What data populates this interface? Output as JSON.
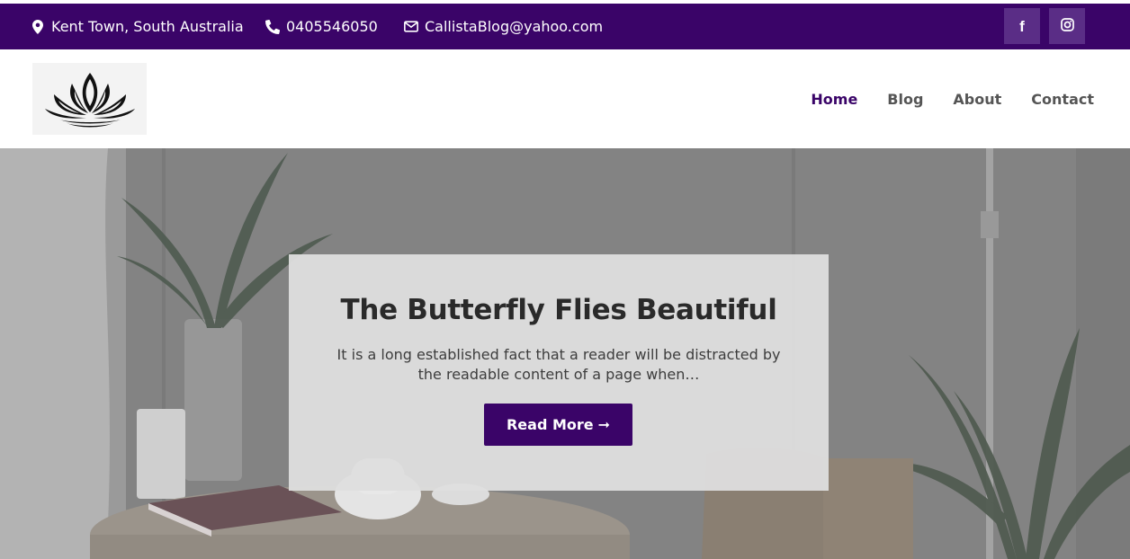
{
  "topbar": {
    "location": "Kent Town, South Australia",
    "phone": "0405546050",
    "email": "CallistaBlog@yahoo.com",
    "social": [
      {
        "icon": "facebook-icon",
        "glyph": "f"
      },
      {
        "icon": "instagram-icon",
        "glyph": ""
      }
    ]
  },
  "nav": {
    "items": [
      {
        "label": "Home",
        "active": true
      },
      {
        "label": "Blog",
        "active": false
      },
      {
        "label": "About",
        "active": false
      },
      {
        "label": "Contact",
        "active": false
      }
    ]
  },
  "hero": {
    "title": "The Butterfly Flies Beautiful",
    "excerpt": "It is a long established fact that a reader will be distracted by the readable content of a page when…",
    "button_label": "Read More",
    "button_arrow": "➞"
  },
  "colors": {
    "brand": "#3a0468",
    "social_bg": "#5a2d86",
    "nav_text": "#555555"
  }
}
